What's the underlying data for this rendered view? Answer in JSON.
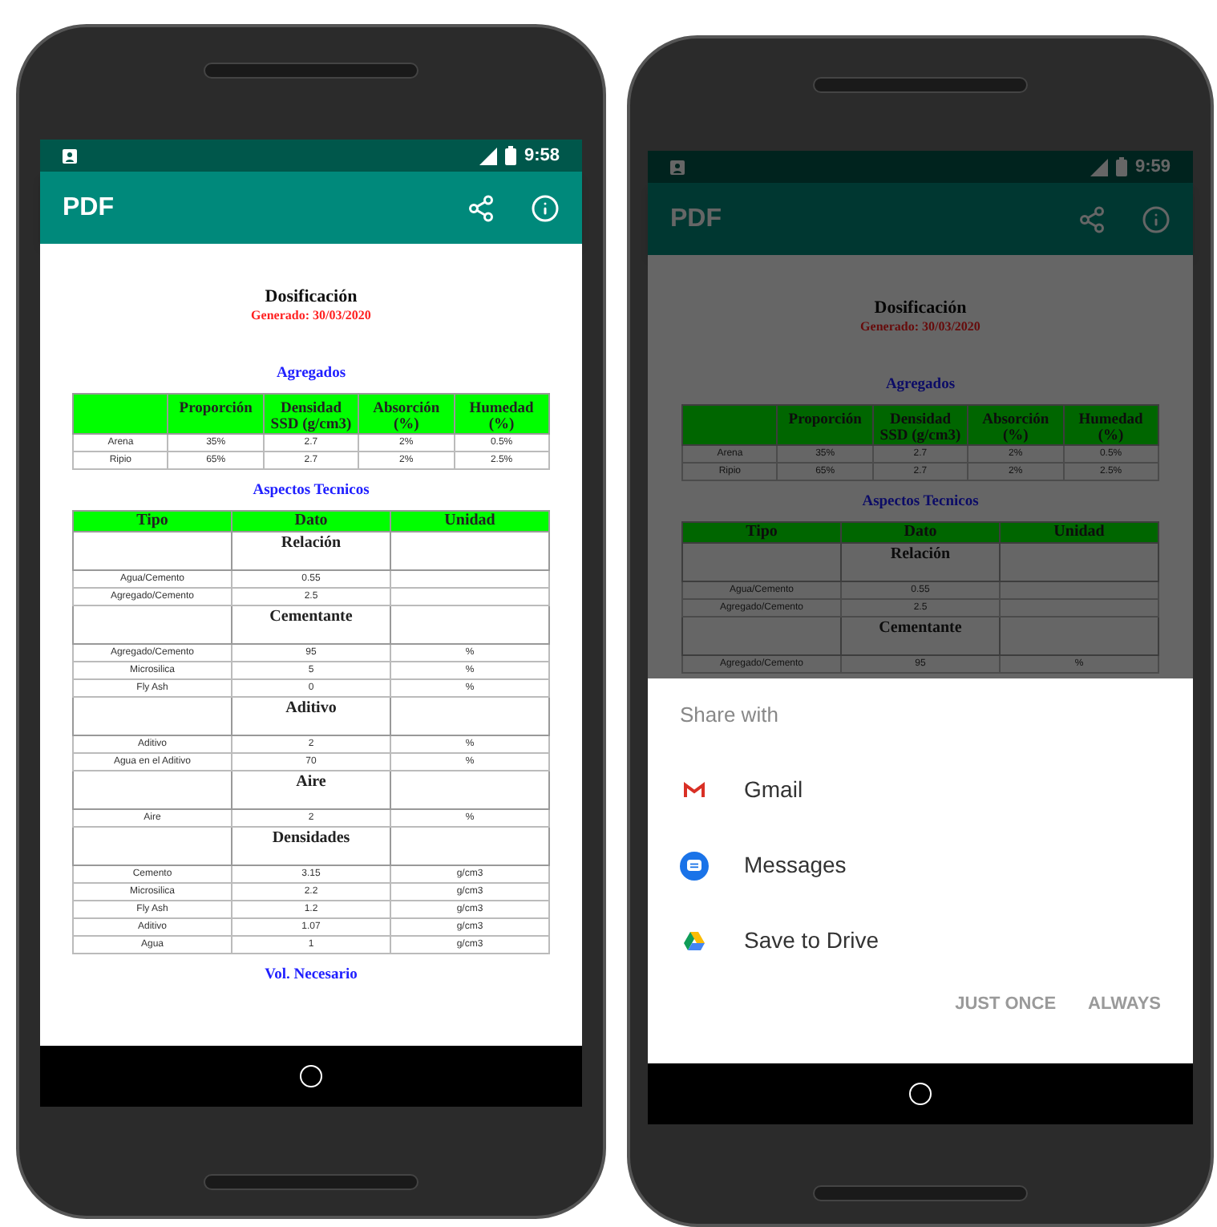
{
  "screens": [
    {
      "status_bar": {
        "time": "9:58"
      },
      "app_bar": {
        "title": "PDF"
      },
      "document": {
        "title": "Dosificación",
        "subtitle": "Generado: 30/03/2020",
        "sections": [
          {
            "kind": "grid",
            "heading": "Agregados",
            "columns": [
              "",
              "Proporción",
              "Densidad SSD (g/cm3)",
              "Absorción (%)",
              "Humedad (%)"
            ],
            "rows": [
              [
                "Arena",
                "35%",
                "2.7",
                "2%",
                "0.5%"
              ],
              [
                "Ripio",
                "65%",
                "2.7",
                "2%",
                "2.5%"
              ]
            ]
          },
          {
            "kind": "grouped",
            "heading": "Aspectos Tecnicos",
            "columns": [
              "Tipo",
              "Dato",
              "Unidad"
            ],
            "groups": [
              {
                "name": "Relación",
                "rows": [
                  [
                    "Agua/Cemento",
                    "0.55"
                  ],
                  [
                    "Agregado/Cemento",
                    "2.5"
                  ]
                ]
              },
              {
                "name": "Cementante",
                "rows": [
                  [
                    "Agregado/Cemento",
                    "95",
                    "%"
                  ],
                  [
                    "Microsilica",
                    "5",
                    "%"
                  ],
                  [
                    "Fly Ash",
                    "0",
                    "%"
                  ]
                ]
              },
              {
                "name": "Aditivo",
                "rows": [
                  [
                    "Aditivo",
                    "2",
                    "%"
                  ],
                  [
                    "Agua en el Aditivo",
                    "70",
                    "%"
                  ]
                ]
              },
              {
                "name": "Aire",
                "rows": [
                  [
                    "Aire",
                    "2",
                    "%"
                  ]
                ]
              },
              {
                "name": "Densidades",
                "rows": [
                  [
                    "Cemento",
                    "3.15",
                    "g/cm3"
                  ],
                  [
                    "Microsilica",
                    "2.2",
                    "g/cm3"
                  ],
                  [
                    "Fly Ash",
                    "1.2",
                    "g/cm3"
                  ],
                  [
                    "Aditivo",
                    "1.07",
                    "g/cm3"
                  ],
                  [
                    "Agua",
                    "1",
                    "g/cm3"
                  ]
                ]
              }
            ]
          },
          {
            "kind": "heading",
            "heading": "Vol. Necesario"
          }
        ]
      }
    },
    {
      "status_bar": {
        "time": "9:59"
      },
      "app_bar": {
        "title": "PDF"
      },
      "document": {
        "title": "Dosificación",
        "subtitle": "Generado: 30/03/2020",
        "sections": [
          {
            "kind": "grid",
            "heading": "Agregados",
            "columns": [
              "",
              "Proporción",
              "Densidad SSD (g/cm3)",
              "Absorción (%)",
              "Humedad (%)"
            ],
            "rows": [
              [
                "Arena",
                "35%",
                "2.7",
                "2%",
                "0.5%"
              ],
              [
                "Ripio",
                "65%",
                "2.7",
                "2%",
                "2.5%"
              ]
            ]
          },
          {
            "kind": "grouped",
            "heading": "Aspectos Tecnicos",
            "columns": [
              "Tipo",
              "Dato",
              "Unidad"
            ],
            "groups": [
              {
                "name": "Relación",
                "rows": [
                  [
                    "Agua/Cemento",
                    "0.55"
                  ],
                  [
                    "Agregado/Cemento",
                    "2.5"
                  ]
                ]
              },
              {
                "name": "Cementante",
                "rows": [
                  [
                    "Agregado/Cemento",
                    "95",
                    "%"
                  ]
                ]
              }
            ]
          }
        ]
      },
      "share_sheet": {
        "title": "Share with",
        "targets": [
          {
            "kind": "gmail",
            "label": "Gmail"
          },
          {
            "kind": "messages",
            "label": "Messages"
          },
          {
            "kind": "drive",
            "label": "Save to Drive"
          }
        ],
        "buttons": [
          {
            "label": "JUST ONCE",
            "disabled": true
          },
          {
            "label": "ALWAYS",
            "disabled": true
          }
        ]
      }
    }
  ]
}
